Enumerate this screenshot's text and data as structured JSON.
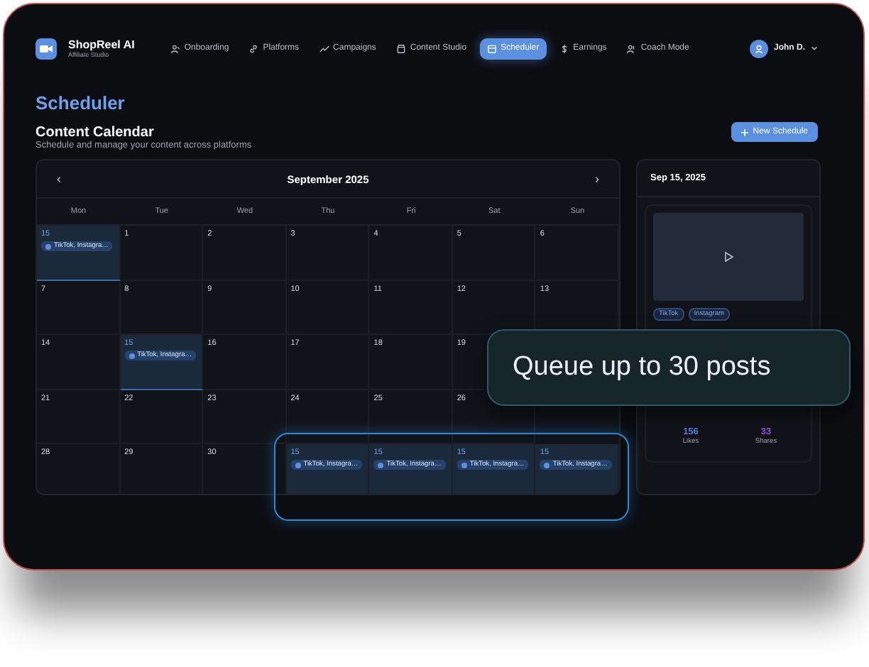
{
  "brand": {
    "name": "ShopReel AI",
    "subtitle": "Affiliate Studio"
  },
  "nav": [
    {
      "label": "Onboarding",
      "selected": false
    },
    {
      "label": "Platforms",
      "selected": false
    },
    {
      "label": "Campaigns",
      "selected": false
    },
    {
      "label": "Content Studio",
      "selected": false
    },
    {
      "label": "Scheduler",
      "selected": true
    },
    {
      "label": "Earnings",
      "selected": false
    },
    {
      "label": "Coach Mode",
      "selected": false
    }
  ],
  "user": {
    "name": "John D."
  },
  "page_title": "Scheduler",
  "section": {
    "title": "Content Calendar",
    "subtitle": "Schedule and manage your content across platforms"
  },
  "new_button": "New Schedule",
  "calendar": {
    "month": "September 2025",
    "prev": "‹",
    "next": "›",
    "weekdays": [
      "Mon",
      "Tue",
      "Wed",
      "Thu",
      "Fri",
      "Sat",
      "Sun"
    ],
    "cells": [
      {
        "day": "15",
        "selected": true,
        "event": "TikTok, Instagra…"
      },
      {
        "day": "1",
        "selected": false
      },
      {
        "day": "2",
        "selected": false
      },
      {
        "day": "3",
        "selected": false
      },
      {
        "day": "4",
        "selected": false
      },
      {
        "day": "5",
        "selected": false
      },
      {
        "day": "6",
        "selected": false
      },
      {
        "day": "7",
        "selected": false
      },
      {
        "day": "8",
        "selected": false
      },
      {
        "day": "9",
        "selected": false
      },
      {
        "day": "10",
        "selected": false
      },
      {
        "day": "11",
        "selected": false
      },
      {
        "day": "12",
        "selected": false
      },
      {
        "day": "13",
        "selected": false
      },
      {
        "day": "14",
        "selected": false
      },
      {
        "day": "15",
        "selected": true,
        "event": "TikTok, Instagra…"
      },
      {
        "day": "16",
        "selected": false
      },
      {
        "day": "17",
        "selected": false
      },
      {
        "day": "18",
        "selected": false
      },
      {
        "day": "19",
        "selected": false
      },
      {},
      {
        "day": "21",
        "selected": false
      },
      {
        "day": "22",
        "selected": false
      },
      {
        "day": "23",
        "selected": false
      },
      {
        "day": "24",
        "selected": false
      },
      {
        "day": "25",
        "selected": false
      },
      {
        "day": "26",
        "selected": false
      },
      {},
      {
        "day": "28",
        "selected": false
      },
      {
        "day": "29",
        "selected": false
      },
      {
        "day": "30",
        "selected": false
      },
      {
        "day": "15",
        "selected": true,
        "event": "TikTok, Instagra…"
      },
      {
        "day": "15",
        "selected": true,
        "event": "TikTok, Instagra…"
      },
      {
        "day": "15",
        "selected": true,
        "event": "TikTok, Instagra…"
      },
      {
        "day": "15",
        "selected": true,
        "event": "TikTok, Instagra…"
      }
    ]
  },
  "detail": {
    "date": "Sep 15, 2025",
    "tags": [
      "TikTok",
      "Instagram"
    ],
    "stats": [
      {
        "value": "156",
        "label": "Likes",
        "color": "#4f7fe0"
      },
      {
        "value": "33",
        "label": "Shares",
        "color": "#9a4fe0"
      }
    ]
  },
  "callout": "Queue up to 30 posts"
}
